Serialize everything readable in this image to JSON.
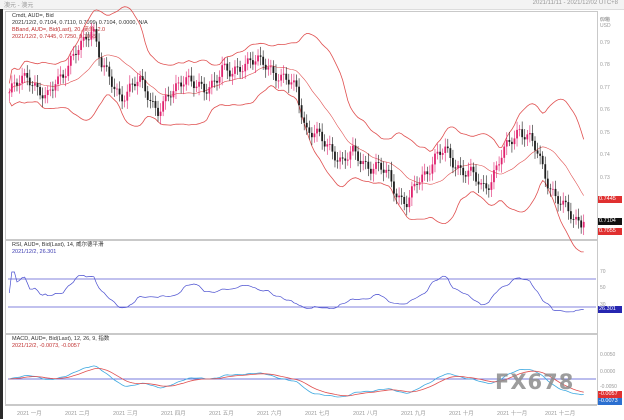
{
  "window": {
    "title_left": "澳元 - 澳元",
    "title_right": "2021/11/11 - 2021/12/02 UTC+8"
  },
  "price_pane": {
    "symbol_line": "Cmdt, AUD=, Bid",
    "ohlc_line": "2021/12/2, 0.7104, 0.7110, 0.7099, 0.7104, 0.0000, N/A",
    "bband_line": "BBand, AUD=, Bid(Last), 20, 简单, 2.0",
    "bband_values": "2021/12/2, 0.7445, 0.7250, 0.7055",
    "unit_label": "价格",
    "unit_sub": "USD",
    "y_ticks": [
      "0.80",
      "0.79",
      "0.78",
      "0.77",
      "0.76",
      "0.75",
      "0.74",
      "0.73",
      "0.72",
      "0.71"
    ],
    "last_price_tag": "0.7104",
    "upper_band_tag": "0.7445",
    "lower_band_tag": "0.7055",
    "colors": {
      "up": "#e0226e",
      "down": "#1c1c1c",
      "band": "#e05050",
      "tag_price": "#111111",
      "tag_band": "#e03030"
    }
  },
  "rsi_pane": {
    "legend_line": "RSI, AUD=, Bid(Last), 14, 威尔德平滑",
    "value_line": "2021/12/2, 26.301",
    "levels": [
      "70",
      "50",
      "30"
    ],
    "last_tag": "26.301",
    "colors": {
      "line": "#4a4fd0",
      "level": "#5a5ad0",
      "tag": "#2626b0"
    }
  },
  "macd_pane": {
    "legend_line": "MACD, AUD=, Bid(Last), 12, 26, 9, 指数",
    "value_line": "2021/12/2, -0.0073, -0.0057",
    "y_ticks": [
      "0.0050",
      "0.0000",
      "-0.0050"
    ],
    "tag_a": "-0.0057",
    "tag_b": "-0.0073",
    "colors": {
      "macd": "#3fa9e0",
      "signal": "#e05050",
      "zero": "#4a4fd0",
      "tag_a": "#e03030",
      "tag_b": "#2b6fd0"
    }
  },
  "x_axis": {
    "labels": [
      "2021 一月",
      "2021 二月",
      "2021 三月",
      "2021 四月",
      "2021 五月",
      "2021 六月",
      "2021 七月",
      "2021 八月",
      "2021 九月",
      "2021 十月",
      "2021 十一月",
      "2021 十二月"
    ]
  },
  "watermark": "FX678",
  "chart_data": {
    "type": "candlestick",
    "title": "",
    "series": [
      {
        "name": "AUD= Bid",
        "last": 0.7104
      },
      {
        "name": "BBand upper",
        "last": 0.7445
      },
      {
        "name": "BBand middle",
        "last": 0.725
      },
      {
        "name": "BBand lower",
        "last": 0.7055
      }
    ],
    "ylim": [
      0.705,
      0.802
    ],
    "approx_closes": [
      0.768,
      0.772,
      0.776,
      0.77,
      0.764,
      0.773,
      0.778,
      0.784,
      0.79,
      0.798,
      0.78,
      0.772,
      0.766,
      0.77,
      0.773,
      0.767,
      0.76,
      0.764,
      0.77,
      0.776,
      0.771,
      0.768,
      0.773,
      0.779,
      0.775,
      0.78,
      0.783,
      0.781,
      0.779,
      0.776,
      0.773,
      0.769,
      0.752,
      0.75,
      0.745,
      0.742,
      0.737,
      0.741,
      0.738,
      0.735,
      0.734,
      0.731,
      0.722,
      0.718,
      0.728,
      0.733,
      0.739,
      0.742,
      0.737,
      0.733,
      0.731,
      0.726,
      0.729,
      0.738,
      0.746,
      0.752,
      0.748,
      0.741,
      0.73,
      0.721,
      0.716,
      0.712,
      0.7104
    ],
    "rsi": {
      "last": 26.301,
      "levels": [
        70,
        50,
        30
      ]
    },
    "macd": {
      "macd_last": -0.0073,
      "signal_last": -0.0057
    }
  }
}
